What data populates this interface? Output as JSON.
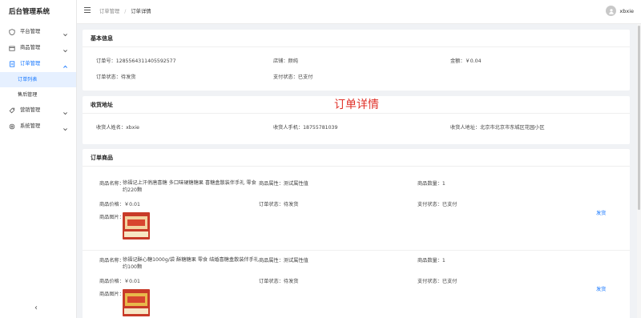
{
  "app": {
    "title": "后台管理系统"
  },
  "sidebar": {
    "items": [
      {
        "label": "平台管理",
        "icon": "shield-icon"
      },
      {
        "label": "商品管理",
        "icon": "box-icon"
      },
      {
        "label": "订单管理",
        "icon": "document-icon",
        "open": true,
        "children": [
          {
            "label": "订单列表",
            "active": true
          },
          {
            "label": "售后管理"
          }
        ]
      },
      {
        "label": "营销管理",
        "icon": "tag-icon"
      },
      {
        "label": "系统管理",
        "icon": "gear-icon"
      }
    ],
    "collapse_glyph": "‹"
  },
  "header": {
    "breadcrumb": [
      "订单管理",
      "订单详情"
    ],
    "breadcrumb_sep": "/",
    "username": "xbxie"
  },
  "overlay_title": "订单详情",
  "basic_info": {
    "title": "基本信息",
    "order_no": "订单号：1285564311405592577",
    "shop": "店铺：颜纯",
    "amount": "金额：￥0.04",
    "order_status": "订单状态：待发货",
    "pay_status": "支付状态：已支付"
  },
  "shipping": {
    "title": "收货地址",
    "name": "收货人姓名：xbxie",
    "phone": "收货人手机：18755781039",
    "address": "收货人地址：北京市北京市东城区花园小区"
  },
  "products": {
    "title": "订单商品",
    "ship_label": "发货",
    "items": [
      {
        "name_label": "商品名称：",
        "name": "徐福记上汗俏唐喜糖 多口味硬糖糖果 喜糖盒散装伴手礼 零食 约220颗",
        "attr": "商品属性：测试属性值",
        "qty": "商品数量：1",
        "price": "商品价格：￥0.01",
        "order_status": "订单状态：待发货",
        "pay_status": "支付状态：已支付",
        "image_label": "商品图片："
      },
      {
        "name_label": "商品名称：",
        "name": "徐福记酥心糖1000g/袋 酥糖糖果 零食 结婚喜糖盒散装伴手礼 约100颗",
        "attr": "商品属性：测试属性值",
        "qty": "商品数量：1",
        "price": "商品价格：￥0.01",
        "order_status": "订单状态：待发货",
        "pay_status": "支付状态：已支付",
        "image_label": "商品图片："
      }
    ]
  },
  "colors": {
    "accent": "#1677ff",
    "overlay": "#e0322a"
  }
}
